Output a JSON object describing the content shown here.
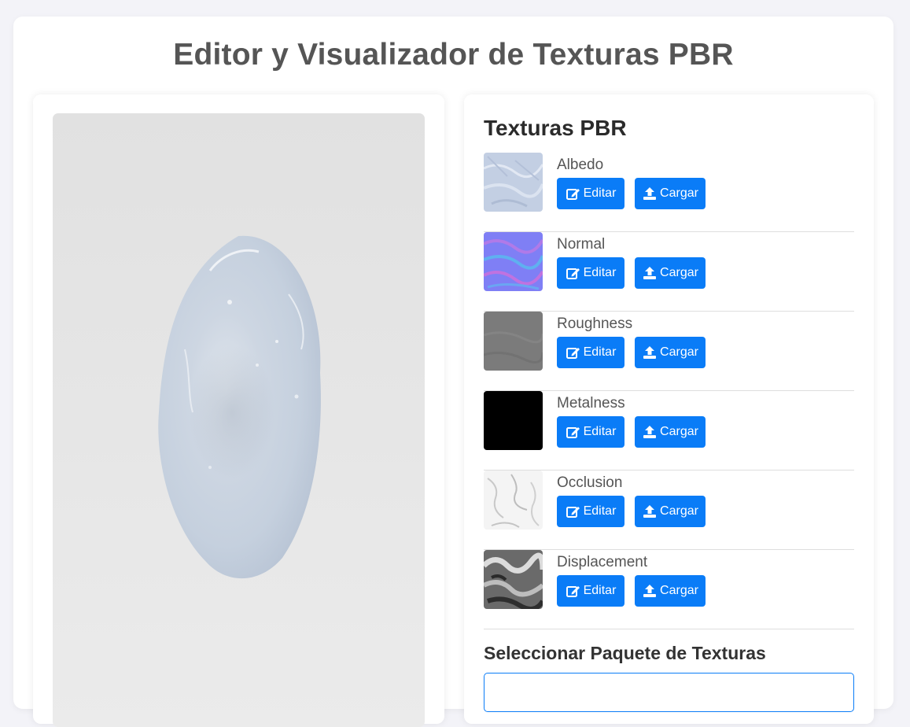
{
  "page": {
    "title": "Editor y Visualizador de Texturas PBR"
  },
  "panel": {
    "title": "Texturas PBR",
    "textures": [
      {
        "name": "Albedo",
        "edit_label": "Editar",
        "load_label": "Cargar"
      },
      {
        "name": "Normal",
        "edit_label": "Editar",
        "load_label": "Cargar"
      },
      {
        "name": "Roughness",
        "edit_label": "Editar",
        "load_label": "Cargar"
      },
      {
        "name": "Metalness",
        "edit_label": "Editar",
        "load_label": "Cargar"
      },
      {
        "name": "Occlusion",
        "edit_label": "Editar",
        "load_label": "Cargar"
      },
      {
        "name": "Displacement",
        "edit_label": "Editar",
        "load_label": "Cargar"
      }
    ],
    "pack_section_title": "Seleccionar Paquete de Texturas"
  },
  "icons": {
    "edit": "edit-icon",
    "load": "upload-icon"
  },
  "colors": {
    "accent": "#0a7cf7",
    "page_bg": "#f3f3f8",
    "viewport_bg": "#e4e4e4"
  }
}
